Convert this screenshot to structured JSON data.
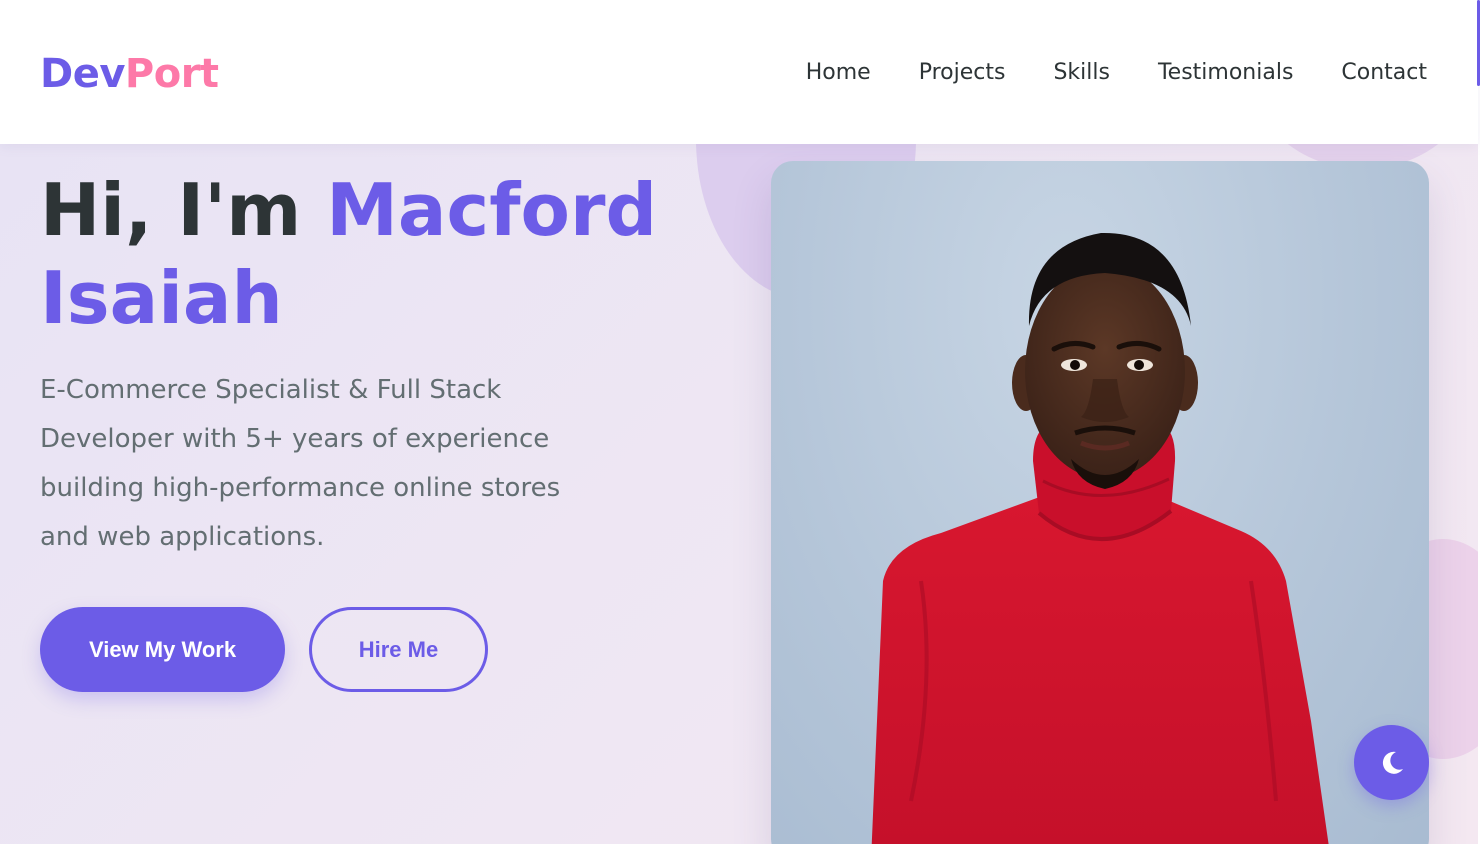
{
  "brand": {
    "part1": "Dev",
    "part2": "Port"
  },
  "nav": {
    "items": [
      {
        "label": "Home"
      },
      {
        "label": "Projects"
      },
      {
        "label": "Skills"
      },
      {
        "label": "Testimonials"
      },
      {
        "label": "Contact"
      }
    ]
  },
  "hero": {
    "greeting": "Hi, I'm ",
    "name": "Macford Isaiah",
    "description": "E-Commerce Specialist & Full Stack Developer with 5+ years of experience building high-performance online stores and web applications.",
    "primary_button": "View My Work",
    "secondary_button": "Hire Me"
  },
  "portrait": {
    "icon": "person-photo"
  },
  "theme_toggle": {
    "icon": "moon-icon"
  },
  "colors": {
    "accent": "#6c5ce7",
    "pink": "#fd79a8",
    "text_dark": "#2d3436",
    "text_muted": "#636e72",
    "shirt_red": "#d11530"
  }
}
